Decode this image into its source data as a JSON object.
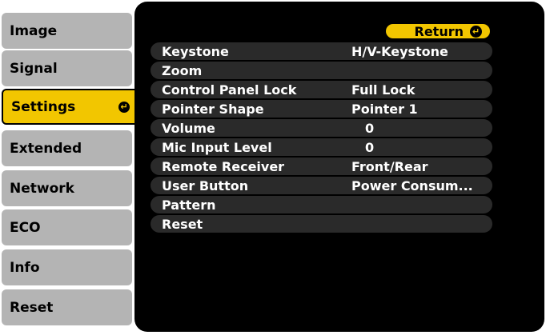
{
  "tabs": [
    {
      "label": "Image",
      "active": false
    },
    {
      "label": "Signal",
      "active": false
    },
    {
      "label": "Settings",
      "active": true
    },
    {
      "label": "Extended",
      "active": false
    },
    {
      "label": "Network",
      "active": false
    },
    {
      "label": "ECO",
      "active": false
    },
    {
      "label": "Info",
      "active": false
    },
    {
      "label": "Reset",
      "active": false
    }
  ],
  "return_button": {
    "label": "Return",
    "icon": "enter-icon"
  },
  "settings": [
    {
      "label": "Keystone",
      "value": "H/V-Keystone"
    },
    {
      "label": "Zoom",
      "value": ""
    },
    {
      "label": "Control Panel Lock",
      "value": "Full Lock"
    },
    {
      "label": "Pointer Shape",
      "value": "Pointer 1"
    },
    {
      "label": "Volume",
      "value": "0"
    },
    {
      "label": "Mic Input Level",
      "value": "0"
    },
    {
      "label": "Remote Receiver",
      "value": "Front/Rear"
    },
    {
      "label": "User Button",
      "value": "Power Consum..."
    },
    {
      "label": "Pattern",
      "value": ""
    },
    {
      "label": "Reset",
      "value": ""
    }
  ],
  "colors": {
    "accent": "#f2c600",
    "panel": "#000000",
    "tab": "#b4b4b4",
    "row": "#2a2a2a"
  }
}
